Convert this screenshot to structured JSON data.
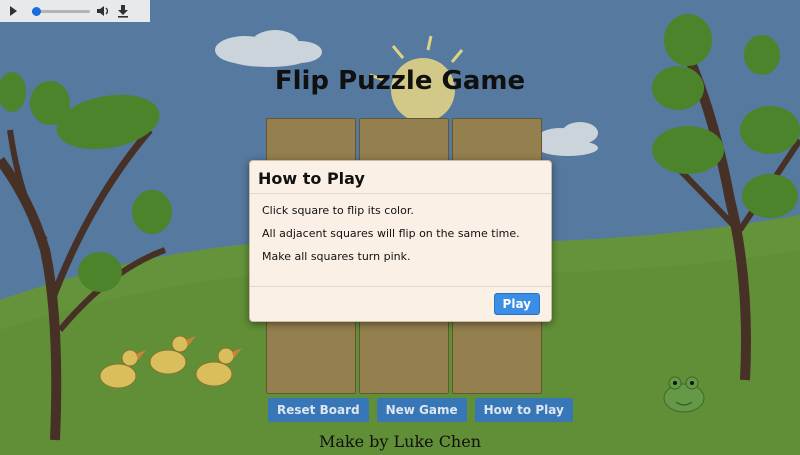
{
  "audio": {
    "play_icon": "play-icon",
    "volume_icon": "volume-icon",
    "download_icon": "download-icon",
    "progress": 0.05
  },
  "game": {
    "title": "Flip Puzzle Game",
    "tiles": [
      "",
      "",
      "",
      "",
      "",
      "",
      "",
      "",
      ""
    ],
    "tile_color": "#9b8552"
  },
  "controls": {
    "reset": "Reset Board",
    "new_game": "New Game",
    "how_to_play": "How to Play"
  },
  "credit": "Make by Luke Chen",
  "modal": {
    "title": "How to Play",
    "lines": [
      "Click square to flip its color.",
      "All adjacent squares will flip on the same time.",
      "Make all squares turn pink."
    ],
    "play_label": "Play"
  },
  "colors": {
    "sky": "#5a7ea6",
    "grass": "#6a9a3e",
    "button": "#3a7bbf"
  }
}
